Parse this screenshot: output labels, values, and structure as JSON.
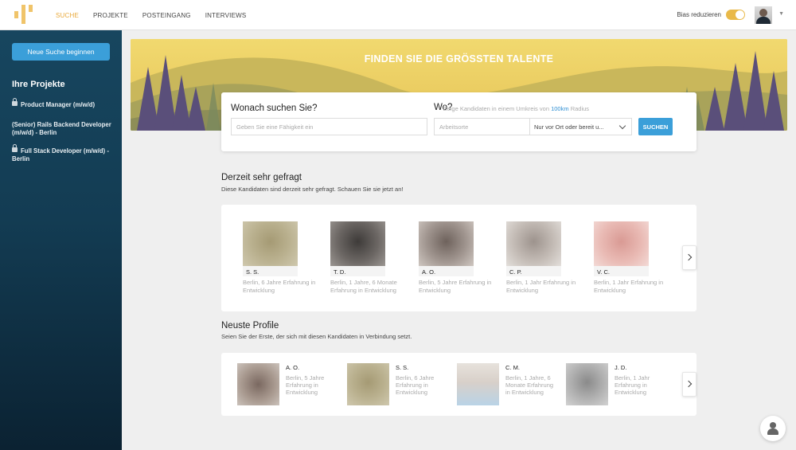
{
  "nav": {
    "items": [
      "SUCHE",
      "PROJEKTE",
      "POSTEINGANG",
      "INTERVIEWS"
    ],
    "active": 0,
    "bias_label": "Bias reduzieren",
    "bias_on": true,
    "accent": "#e9a93a"
  },
  "sidebar": {
    "new_search": "Neue Suche beginnen",
    "projects_title": "Ihre Projekte",
    "projects": [
      {
        "label": "Product Manager (m/w/d)",
        "locked": true
      },
      {
        "label": "(Senior) Rails Backend Developer (m/w/d) - Berlin",
        "locked": false
      },
      {
        "label": "Full Stack Developer (m/w/d) - Berlin",
        "locked": true
      }
    ]
  },
  "hero": {
    "title": "FINDEN SIE DIE GRÖSSTEN TALENTE"
  },
  "search": {
    "what_label": "Wonach suchen Sie?",
    "what_placeholder": "Geben Sie eine Fähigkeit ein",
    "where_label": "Wo?",
    "hint_before": "Zeige Kandidaten in einem Umkreis von",
    "hint_km": "100km",
    "hint_after": "Radius",
    "where_placeholder": "Arbeitsorte",
    "select_value": "Nur vor Ort oder bereit u...",
    "button": "SUCHEN",
    "button_color": "#3b9fd9"
  },
  "popular": {
    "title": "Derzeit sehr gefragt",
    "subtitle": "Diese Kandidaten sind derzeit sehr gefragt. Schauen Sie sie jetzt an!",
    "candidates": [
      {
        "initials": "S. S.",
        "meta": "Berlin, 6 Jahre Erfahrung in Entwicklung"
      },
      {
        "initials": "T. D.",
        "meta": "Berlin, 1 Jahre, 6 Monate Erfahrung in Entwicklung"
      },
      {
        "initials": "A. O.",
        "meta": "Berlin, 5 Jahre Erfahrung in Entwicklung"
      },
      {
        "initials": "C. P.",
        "meta": "Berlin, 1 Jahr Erfahrung in Entwicklung"
      },
      {
        "initials": "V. C.",
        "meta": "Berlin, 1 Jahr Erfahrung in Entwicklung"
      }
    ]
  },
  "newest": {
    "title": "Neuste Profile",
    "subtitle": "Seien Sie der Erste, der sich mit diesen Kandidaten in Verbindung setzt.",
    "profiles": [
      {
        "initials": "A. O.",
        "meta": "Berlin, 5 Jahre Erfahrung in Entwicklung"
      },
      {
        "initials": "S. S.",
        "meta": "Berlin, 6 Jahre Erfahrung in Entwicklung"
      },
      {
        "initials": "C. M.",
        "meta": "Berlin, 1 Jahre, 6 Monate Erfahrung in Entwicklung"
      },
      {
        "initials": "J. D.",
        "meta": "Berlin, 1 Jahr Erfahrung in Entwicklung"
      }
    ]
  }
}
